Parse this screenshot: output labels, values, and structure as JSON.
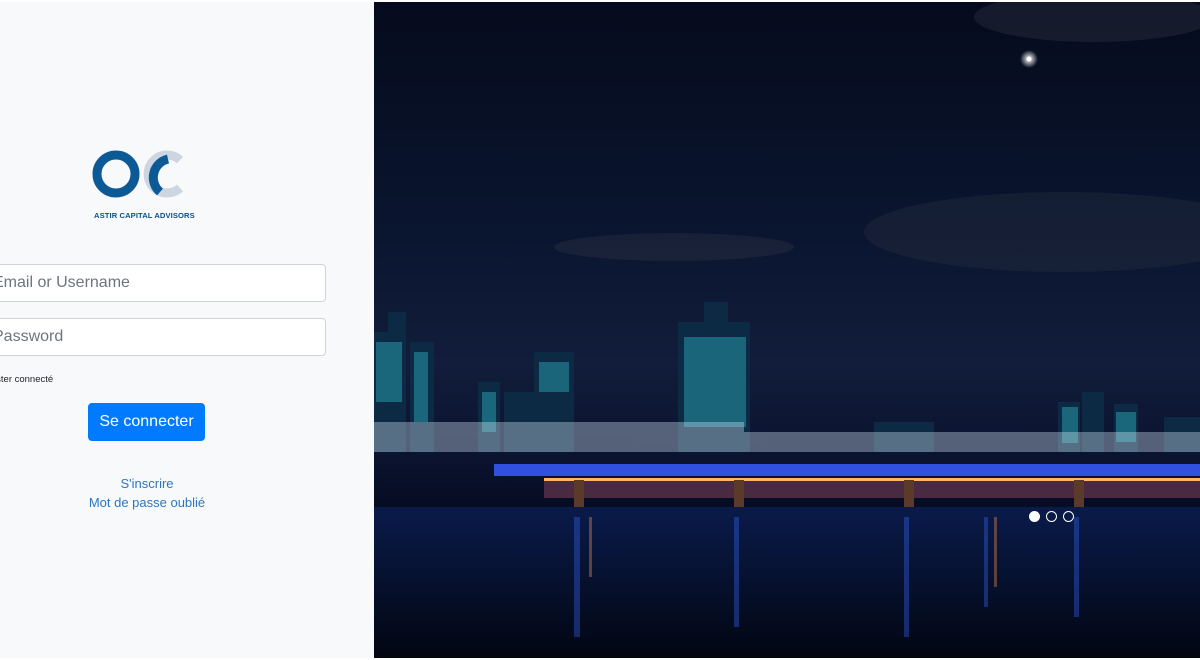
{
  "brand": {
    "name": "ASTIR CAPITAL ADVISORS",
    "primary_color": "#0b5a96",
    "secondary_color": "#cdd6e0"
  },
  "login_form": {
    "email_placeholder": "Email or Username",
    "password_placeholder": "Password",
    "remember_label": "Rester connecté",
    "submit_label": "Se connecter",
    "signup_link": "S'inscrire",
    "forgot_link": "Mot de passe oublié",
    "button_color": "#007bff",
    "link_color": "#2a77c4"
  },
  "carousel": {
    "slide_count": 3,
    "active_slide": 1,
    "image_subject": "night-city-skyline-river-bridge"
  }
}
